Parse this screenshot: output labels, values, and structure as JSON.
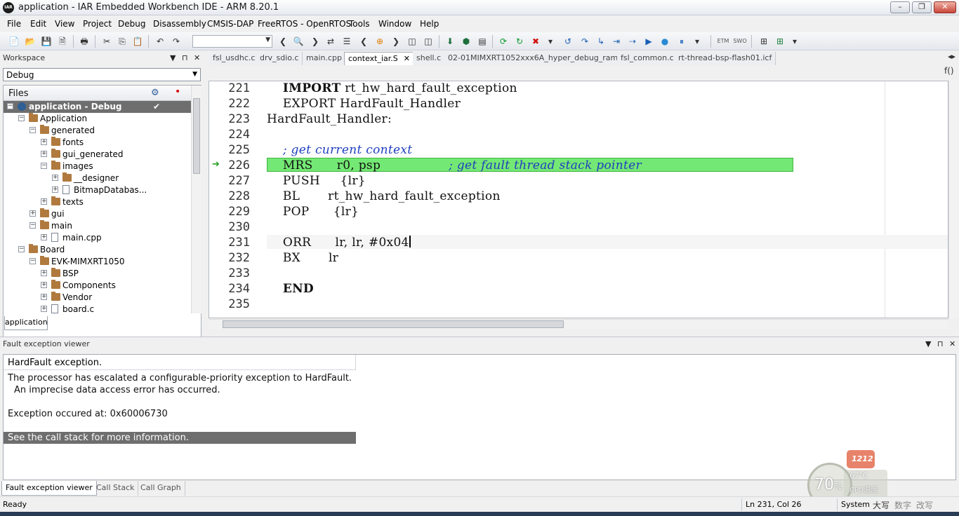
{
  "window": {
    "title": "application - IAR Embedded Workbench IDE - ARM 8.20.1",
    "app_icon": "IAR"
  },
  "menu": [
    "File",
    "Edit",
    "View",
    "Project",
    "Debug",
    "Disassembly",
    "CMSIS-DAP",
    "FreeRTOS - OpenRTOS",
    "Tools",
    "Window",
    "Help"
  ],
  "toolbar": {
    "combo_value": "",
    "etm_label": "ETM",
    "swo_label": "SWO"
  },
  "workspace": {
    "title": "Workspace",
    "config": "Debug",
    "files_header": "Files",
    "tab": "application",
    "tree": [
      {
        "label": "application - Debug",
        "selected": true
      },
      {
        "label": "Application"
      },
      {
        "label": "generated"
      },
      {
        "label": "fonts"
      },
      {
        "label": "gui_generated"
      },
      {
        "label": "images"
      },
      {
        "label": "__designer"
      },
      {
        "label": "BitmapDatabas..."
      },
      {
        "label": "texts"
      },
      {
        "label": "gui"
      },
      {
        "label": "main"
      },
      {
        "label": "main.cpp"
      },
      {
        "label": "Board"
      },
      {
        "label": "EVK-MIMXRT1050"
      },
      {
        "label": "BSP"
      },
      {
        "label": "Components"
      },
      {
        "label": "Vendor"
      },
      {
        "label": "board.c"
      }
    ]
  },
  "editor": {
    "tabs": [
      "fsl_usdhc.c",
      "drv_sdio.c",
      "main.cpp",
      "context_iar.S",
      "shell.c",
      "02-01MIMXRT1052xxx6A_hyper_debug_ram.icf",
      "fsl_common.c",
      "rt-thread-bsp-flash01.icf"
    ],
    "active_tab": "context_iar.S",
    "fx_label": "f()",
    "lines": [
      {
        "num": "221",
        "text": "    IMPORT rt_hw_hard_fault_exception"
      },
      {
        "num": "222",
        "text": "    EXPORT HardFault_Handler"
      },
      {
        "num": "223",
        "text": "HardFault_Handler:"
      },
      {
        "num": "224",
        "text": ""
      },
      {
        "num": "225",
        "text": "    ; get current context"
      },
      {
        "num": "226",
        "text": "    MRS      r0, psp                 ; get fault thread stack pointer"
      },
      {
        "num": "227",
        "text": "    PUSH     {lr}"
      },
      {
        "num": "228",
        "text": "    BL       rt_hw_hard_fault_exception"
      },
      {
        "num": "229",
        "text": "    POP      {lr}"
      },
      {
        "num": "230",
        "text": ""
      },
      {
        "num": "231",
        "text": "    ORR      lr, lr, #0x04"
      },
      {
        "num": "232",
        "text": "    BX       lr"
      },
      {
        "num": "233",
        "text": ""
      },
      {
        "num": "234",
        "text": "    END"
      },
      {
        "num": "235",
        "text": ""
      }
    ],
    "code": {
      "l221a": "IMPORT",
      "l221b": " rt_hw_hard_fault_exception",
      "l222": "EXPORT HardFault_Handler",
      "l223": "HardFault_Handler:",
      "l225": "; get current context",
      "l226a": "MRS      r0, psp",
      "l226b": "; get fault thread stack pointer",
      "l227": "PUSH     {lr}",
      "l228": "BL       rt_hw_hard_fault_exception",
      "l229": "POP      {lr}",
      "l231": "ORR      lr, lr, #0x04",
      "l232": "BX       lr",
      "l234": "END"
    },
    "highlight_color": "#74e874"
  },
  "fault_viewer": {
    "title": "Fault exception viewer",
    "header": "HardFault exception.",
    "line1": "The processor has escalated a configurable-priority exception to HardFault.",
    "line2": "An imprecise data access error has occurred.",
    "line3": "Exception occured at: 0x60006730",
    "info": "See the call stack for more information.",
    "tabs": [
      "Fault exception viewer",
      "Call Stack",
      "Call Graph"
    ]
  },
  "status": {
    "ready": "Ready",
    "position": "Ln 231, Col 26",
    "system": "System",
    "ime": [
      "大写",
      "数字",
      "改写"
    ]
  },
  "cpu_widget": {
    "percent": "70",
    "percent_sign": "%",
    "temp": "67℃",
    "label": "CPU温度",
    "badge": "1212"
  }
}
